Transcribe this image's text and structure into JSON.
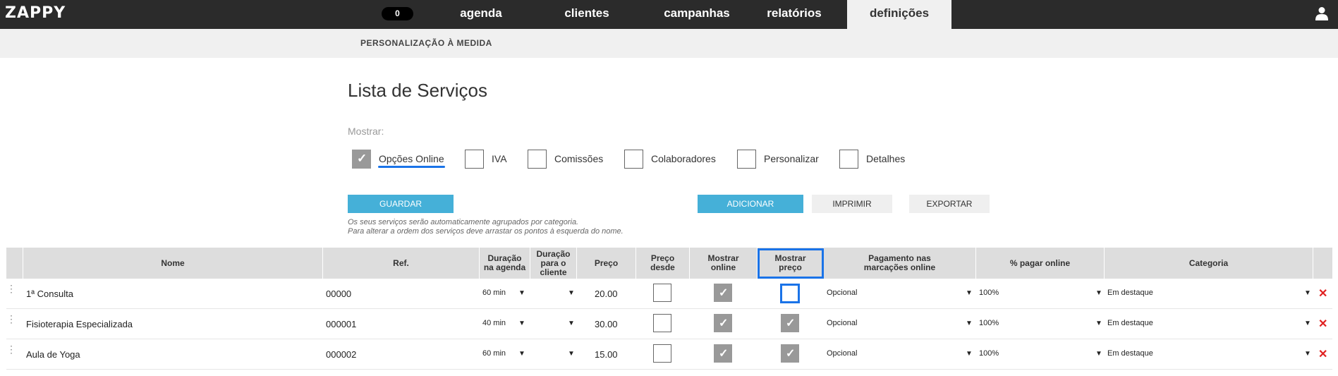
{
  "app": {
    "logo": "ZAPPY",
    "counter": "0"
  },
  "nav": {
    "items": [
      "agenda",
      "clientes",
      "campanhas",
      "relatórios",
      "definições"
    ],
    "active": "definições"
  },
  "subnav": {
    "label": "PERSONALIZAÇÃO À MEDIDA"
  },
  "page": {
    "title": "Lista de Serviços",
    "show_label": "Mostrar:",
    "options": [
      {
        "label": "Opções Online",
        "checked": true
      },
      {
        "label": "IVA",
        "checked": false
      },
      {
        "label": "Comissões",
        "checked": false
      },
      {
        "label": "Colaboradores",
        "checked": false
      },
      {
        "label": "Personalizar",
        "checked": false
      },
      {
        "label": "Detalhes",
        "checked": false
      }
    ],
    "buttons": {
      "save": "GUARDAR",
      "add": "ADICIONAR",
      "print": "IMPRIMIR",
      "export": "EXPORTAR"
    },
    "hint1": "Os seus serviços serão automaticamente agrupados por categoria.",
    "hint2": "Para alterar a ordem dos serviços deve arrastar os pontos à esquerda do nome."
  },
  "table": {
    "headers": {
      "nome": "Nome",
      "ref": "Ref.",
      "duracao_agenda": [
        "Duração",
        "na agenda"
      ],
      "duracao_cliente": [
        "Duração",
        "para o",
        "cliente"
      ],
      "preco": "Preço",
      "preco_desde": [
        "Preço",
        "desde"
      ],
      "mostrar_online": [
        "Mostrar",
        "online"
      ],
      "mostrar_preco": [
        "Mostrar",
        "preço"
      ],
      "pagamento": [
        "Pagamento nas",
        "marcações online"
      ],
      "pagar_online": "% pagar online",
      "categoria": "Categoria"
    },
    "rows": [
      {
        "nome": "1ª Consulta",
        "ref": "00000",
        "duracao": "60 min",
        "preco": "20.00",
        "preco_desde": false,
        "mostrar_online": true,
        "mostrar_preco": false,
        "pagamento": "Opcional",
        "pagar_online": "100%",
        "categoria": "Em destaque"
      },
      {
        "nome": "Fisioterapia Especializada",
        "ref": "000001",
        "duracao": "40 min",
        "preco": "30.00",
        "preco_desde": false,
        "mostrar_online": true,
        "mostrar_preco": true,
        "pagamento": "Opcional",
        "pagar_online": "100%",
        "categoria": "Em destaque"
      },
      {
        "nome": "Aula de Yoga",
        "ref": "000002",
        "duracao": "60 min",
        "preco": "15.00",
        "preco_desde": false,
        "mostrar_online": true,
        "mostrar_preco": true,
        "pagamento": "Opcional",
        "pagar_online": "100%",
        "categoria": "Em destaque"
      }
    ]
  },
  "icons": {
    "user": "user-icon",
    "delete": "delete-icon",
    "drag": "drag-handle-icon",
    "dropdown": "chevron-down-icon"
  },
  "colors": {
    "accent": "#45b0d8",
    "focus": "#1a73e8",
    "topbar": "#2b2b2b",
    "delete": "#e02020"
  }
}
